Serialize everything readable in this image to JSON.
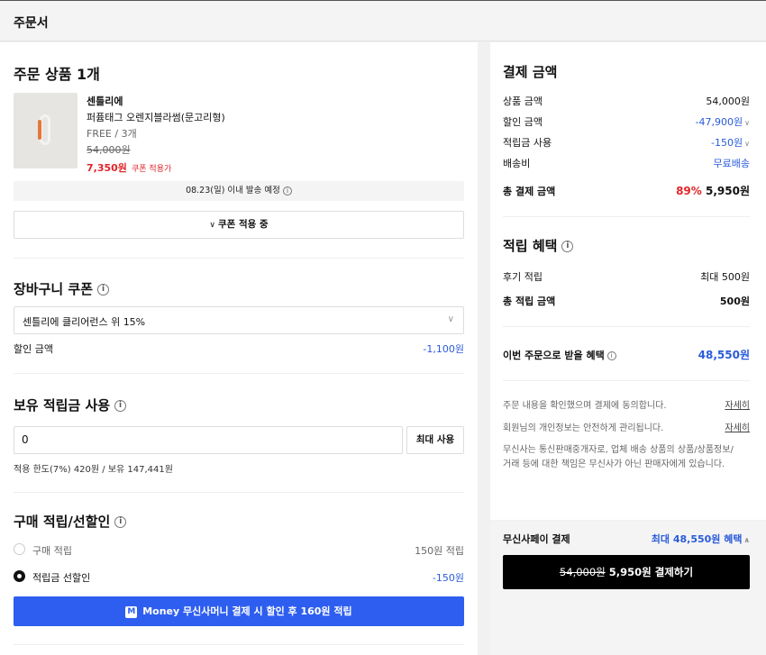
{
  "header": {
    "title": "주문서"
  },
  "product_section": {
    "title": "주문 상품 1개",
    "brand": "센틀리에",
    "name": "퍼퓸태그 오렌지블라썸(문고리형)",
    "option": "FREE / 3개",
    "original_price": "54,000원",
    "sale_price": "7,350원",
    "coupon_note": "쿠폰 적용가",
    "shipping_note": "08.23(일) 이내 발송 예정",
    "coupon_button": "쿠폰 적용 중"
  },
  "cart_coupon": {
    "title": "장바구니 쿠폰",
    "selected": "센틀리에 클리어런스 위 15%",
    "discount_label": "할인 금액",
    "discount_value": "-1,100원"
  },
  "points": {
    "title": "보유 적립금 사용",
    "input_value": "0",
    "max_button": "최대 사용",
    "limit_note": "적용 한도(7%) 420원 / 보유 147,441원"
  },
  "purchase_reward": {
    "title": "구매 적립/선할인",
    "options": [
      {
        "label": "구매 적립",
        "value": "150원 적립",
        "selected": false
      },
      {
        "label": "적립금 선할인",
        "value": "-150원",
        "selected": true
      }
    ],
    "money_logo": "M",
    "money_button": "Money 무신사머니 결제 시 할인 후 160원 적립"
  },
  "payment_summary": {
    "title": "결제 금액",
    "rows": [
      {
        "label": "상품 금액",
        "value": "54,000원"
      },
      {
        "label": "할인 금액",
        "value": "-47,900원"
      },
      {
        "label": "적립금 사용",
        "value": "-150원"
      },
      {
        "label": "배송비",
        "value": "무료배송"
      }
    ],
    "total_label": "총 결제 금액",
    "total_percent": "89%",
    "total_value": "5,950원"
  },
  "reward_summary": {
    "title": "적립 혜택",
    "review_label": "후기 적립",
    "review_value": "최대 500원",
    "total_label": "총 적립 금액",
    "total_value": "500원",
    "benefit_label": "이번 주문으로 받을 혜택",
    "benefit_value": "48,550원"
  },
  "agreements": {
    "line1": "주문 내용을 확인했으며 결제에 동의합니다.",
    "line2": "회원님의 개인정보는 안전하게 관리됩니다.",
    "detail_link": "자세히",
    "notice": "무신사는 통신판매중개자로, 업체 배송 상품의 상품/상품정보/",
    "notice2": "거래 등에 대한 책임은 무신사가 아닌 판매자에게 있습니다."
  },
  "pay_bar": {
    "method": "무신사페이 결제",
    "benefit": "최대 48,550원 혜택",
    "button_original": "54,000원",
    "button_text": "5,950원 결제하기"
  },
  "colors": {
    "accent_blue": "#2e5ef0",
    "price_red": "#e0262a"
  }
}
